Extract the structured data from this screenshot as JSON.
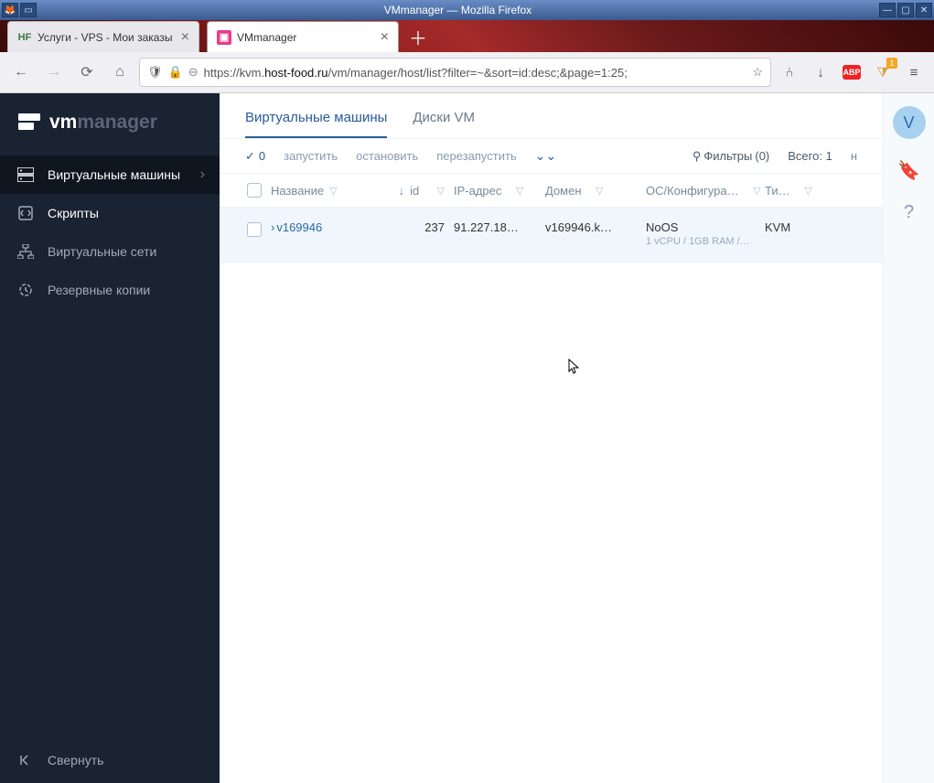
{
  "window": {
    "title": "VMmanager — Mozilla Firefox"
  },
  "browser": {
    "tabs": [
      {
        "favicon": "HF",
        "favicon_color": "#3a7a3a",
        "title": "Услуги - VPS - Мои заказы",
        "active": false
      },
      {
        "favicon": "▣",
        "favicon_bg": "#e83e8c",
        "title": "VMmanager",
        "active": true
      }
    ],
    "url_prefix": "https://kvm.",
    "url_domain": "host-food.ru",
    "url_path": "/vm/manager/host/list?filter=~&sort=id:desc;&page=1:25;",
    "ext_badge": "1",
    "abp": "ABP"
  },
  "logo": {
    "vm": "vm",
    "manager": "manager"
  },
  "sidebar": {
    "items": [
      {
        "label": "Виртуальные машины",
        "active": true
      },
      {
        "label": "Скрипты",
        "active": false
      },
      {
        "label": "Виртуальные сети",
        "active": false
      },
      {
        "label": "Резервные копии",
        "active": false
      }
    ],
    "collapse": "Свернуть"
  },
  "tabs": [
    {
      "label": "Виртуальные машины",
      "active": true
    },
    {
      "label": "Диски VM",
      "active": false
    }
  ],
  "toolbar": {
    "selected": "0",
    "start": "запустить",
    "stop": "остановить",
    "restart": "перезапустить",
    "filters_label": "Фильтры",
    "filters_count": "(0)",
    "total_label": "Всего:",
    "total_value": "1",
    "next": "н"
  },
  "columns": {
    "name": "Название",
    "id": "id",
    "ip": "IP-адрес",
    "domain": "Домен",
    "os": "ОС/Конфигура…",
    "type": "Ти…"
  },
  "rows": [
    {
      "name": "v169946",
      "id": "237",
      "ip": "91.227.18…",
      "domain": "v169946.k…",
      "os": "NoOS",
      "config": "1 vCPU / 1GB RAM /…",
      "type": "KVM"
    }
  ],
  "rightbar": {
    "avatar": "V"
  }
}
